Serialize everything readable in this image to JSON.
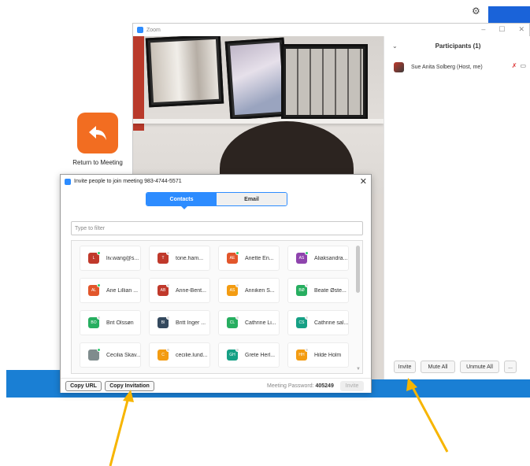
{
  "colors": {
    "zoom_blue": "#2d8cff",
    "return_orange": "#f26d21",
    "taskbar": "#1a7fd4",
    "arrow": "#f7b500"
  },
  "desktop": {
    "return_label": "Return to Meeting"
  },
  "zoom": {
    "title": "Zoom",
    "controls": [
      "–",
      "☐",
      "✕"
    ],
    "participants": {
      "header": "Participants (1)",
      "collapse": "⌄",
      "list": [
        {
          "name": "Sue Anita Solberg (Host, me)"
        }
      ],
      "buttons": [
        "Invite",
        "Mute All",
        "Unmute All",
        "..."
      ]
    }
  },
  "invite": {
    "title": "Invite people to join meeting 983-4744-5571",
    "close": "✕",
    "tabs": [
      "Contacts",
      "Email"
    ],
    "filter_placeholder": "Type to filter",
    "contacts": [
      {
        "initials": "L",
        "name": "liv.wang@s...",
        "color": "#c0392b",
        "status": "#2ecc71"
      },
      {
        "initials": "T",
        "name": "tone.ham...",
        "color": "#c0392b",
        "status": "#dddddd"
      },
      {
        "initials": "AE",
        "name": "Anette En...",
        "color": "#e2562b",
        "status": "#2ecc71"
      },
      {
        "initials": "AS",
        "name": "Aliaksandra...",
        "color": "#8e44ad",
        "status": "#2ecc71"
      },
      {
        "initials": "AL",
        "name": "Ane Lillian ...",
        "color": "#e2562b",
        "status": "#2ecc71"
      },
      {
        "initials": "AB",
        "name": "Anne-Bent...",
        "color": "#c0392b",
        "status": "#dddddd"
      },
      {
        "initials": "AS",
        "name": "Anniken S...",
        "color": "#f39c12",
        "status": "#dddddd"
      },
      {
        "initials": "BØ",
        "name": "Beate Øste...",
        "color": "#27ae60",
        "status": "#dddddd"
      },
      {
        "initials": "BO",
        "name": "Brit Olssøn",
        "color": "#27ae60",
        "status": "#dddddd"
      },
      {
        "initials": "BI",
        "name": "Britt Inger ...",
        "color": "#34495e",
        "status": "#dddddd"
      },
      {
        "initials": "CL",
        "name": "Cathrine Li...",
        "color": "#27ae60",
        "status": "#dddddd"
      },
      {
        "initials": "CS",
        "name": "Cathrine sal...",
        "color": "#16a085",
        "status": "#dddddd"
      },
      {
        "initials": "",
        "name": "Cecilia Skav...",
        "color": "#7f8c8d",
        "status": "#2ecc71"
      },
      {
        "initials": "C",
        "name": "cecilie.lund...",
        "color": "#f39c12",
        "status": "#dddddd"
      },
      {
        "initials": "GH",
        "name": "Grete Herl...",
        "color": "#16a085",
        "status": "#dddddd"
      },
      {
        "initials": "HH",
        "name": "Hilde Holm",
        "color": "#f39c12",
        "status": "#dddddd"
      }
    ],
    "copy_url": "Copy URL",
    "copy_invitation": "Copy Invitation",
    "password_label": "Meeting Password:",
    "password_value": "405249",
    "invite_button": "Invite"
  }
}
